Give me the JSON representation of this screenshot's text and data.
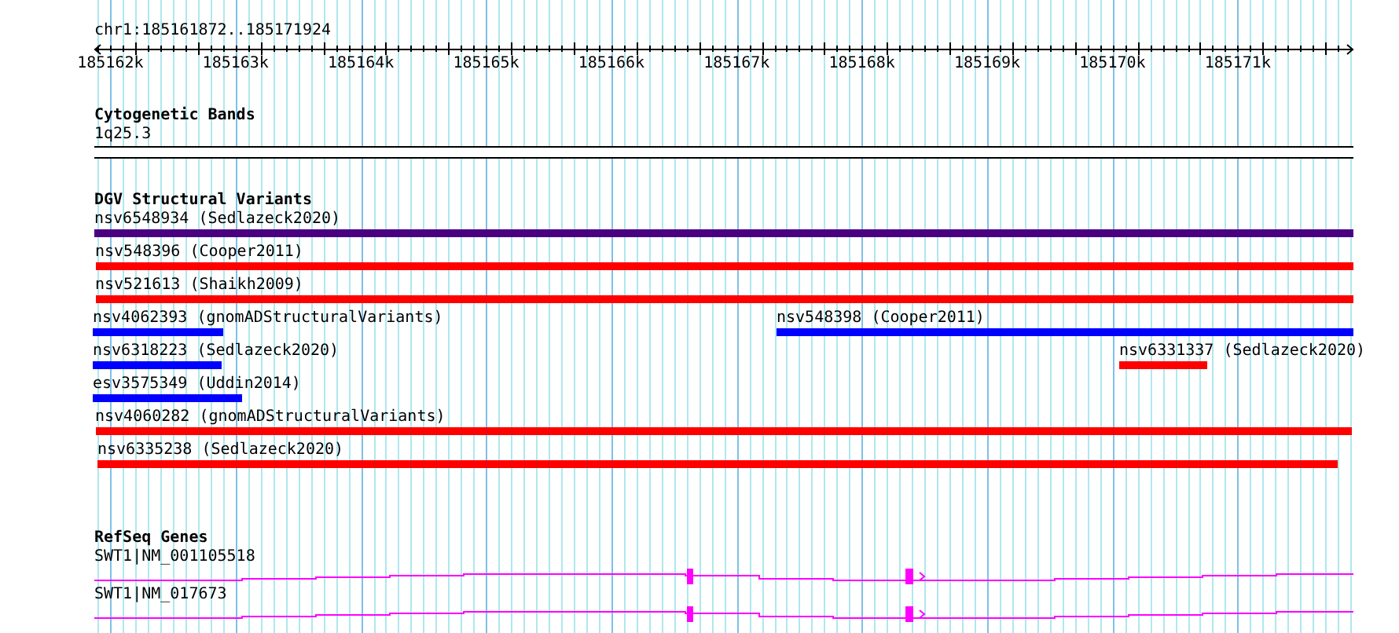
{
  "location": "chr1:185161872..185171924",
  "ruler": {
    "ticks": [
      {
        "label": "185162k"
      },
      {
        "label": "185163k"
      },
      {
        "label": "185164k"
      },
      {
        "label": "185165k"
      },
      {
        "label": "185166k"
      },
      {
        "label": "185167k"
      },
      {
        "label": "185168k"
      },
      {
        "label": "185169k"
      },
      {
        "label": "185170k"
      },
      {
        "label": "185171k"
      }
    ]
  },
  "tracks": [
    {
      "kind": "cytoband",
      "title": "Cytogenetic Bands",
      "bands": [
        {
          "name": "1q25.3"
        }
      ]
    },
    {
      "kind": "variants",
      "title": "DGV Structural Variants",
      "rows": [
        {
          "features": [
            {
              "label": "nsv6548934 (Sedlazeck2020)",
              "color": "#4b0082"
            }
          ]
        },
        {
          "features": [
            {
              "label": "nsv548396 (Cooper2011)",
              "color": "#ff0000"
            }
          ]
        },
        {
          "features": [
            {
              "label": "nsv521613 (Shaikh2009)",
              "color": "#ff0000"
            }
          ]
        },
        {
          "features": [
            {
              "label": "nsv4062393 (gnomADStructuralVariants)",
              "color": "#0000ff"
            },
            {
              "label": "nsv548398 (Cooper2011)",
              "color": "#0000ff"
            }
          ]
        },
        {
          "features": [
            {
              "label": "nsv6318223 (Sedlazeck2020)",
              "color": "#0000ff"
            },
            {
              "label": "nsv6331337 (Sedlazeck2020)",
              "color": "#ff0000"
            }
          ]
        },
        {
          "features": [
            {
              "label": "esv3575349 (Uddin2014)",
              "color": "#0000ff"
            }
          ]
        },
        {
          "features": [
            {
              "label": "nsv4060282 (gnomADStructuralVariants)",
              "color": "#ff0000"
            }
          ]
        },
        {
          "features": [
            {
              "label": "nsv6335238 (Sedlazeck2020)",
              "color": "#ff0000"
            }
          ]
        }
      ]
    },
    {
      "kind": "genes",
      "title": "RefSeq Genes",
      "genes": [
        {
          "label": "SWT1|NM_001105518"
        },
        {
          "label": "SWT1|NM_017673"
        }
      ]
    }
  ]
}
